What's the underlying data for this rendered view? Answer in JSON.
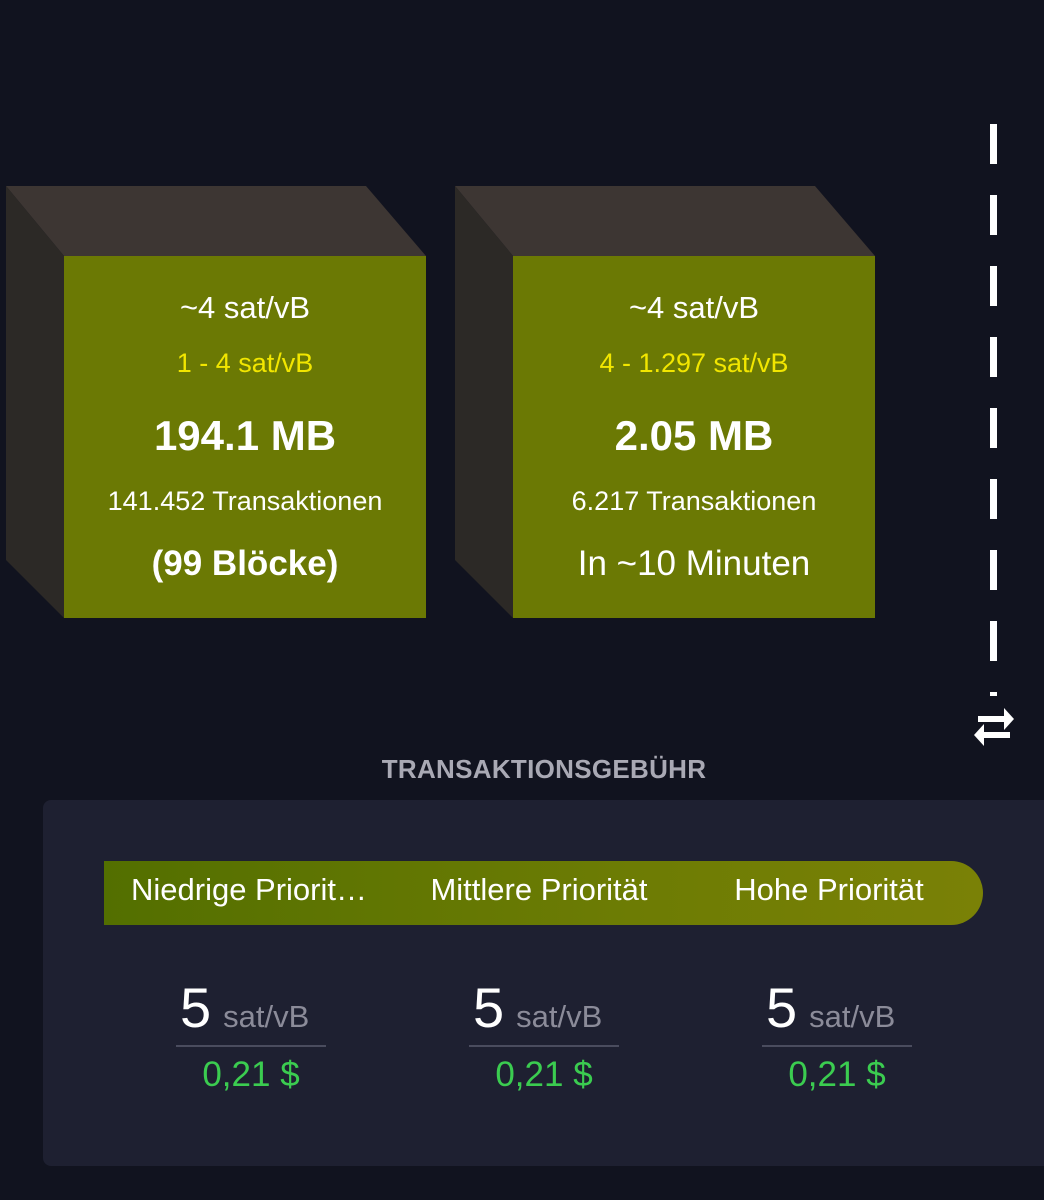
{
  "blocks": [
    {
      "median_fee": "~4 sat/vB",
      "fee_range": "1 - 4 sat/vB",
      "size": "194.1 MB",
      "tx_count": "141.452 Transaktionen",
      "eta": "(99 Blöcke)"
    },
    {
      "median_fee": "~4 sat/vB",
      "fee_range": "4 - 1.297 sat/vB",
      "size": "2.05 MB",
      "tx_count": "6.217 Transaktionen",
      "eta": "In ~10 Minuten"
    }
  ],
  "divider": {
    "icon": "swap-arrows-icon"
  },
  "fees": {
    "title": "TRANSAKTIONSGEBÜHR",
    "priorities": [
      {
        "label": "Niedrige Priorit…",
        "value": "5",
        "unit": "sat/vB",
        "fiat": "0,21 $"
      },
      {
        "label": "Mittlere Priorität",
        "value": "5",
        "unit": "sat/vB",
        "fiat": "0,21 $"
      },
      {
        "label": "Hohe Priorität",
        "value": "5",
        "unit": "sat/vB",
        "fiat": "0,21 $"
      }
    ]
  },
  "colors": {
    "background": "#11131f",
    "block_face": "#6b7904",
    "fee_range": "#f2e600",
    "card": "#1e2031",
    "fiat": "#3bcc50"
  }
}
